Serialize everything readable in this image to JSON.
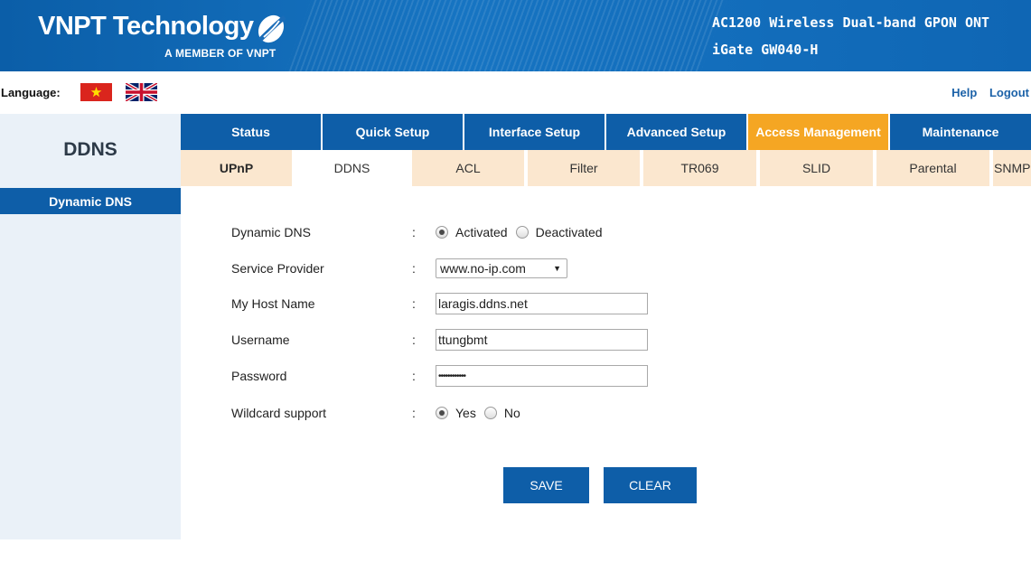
{
  "header": {
    "brand": "VNPT Technology",
    "brand_sub": "A MEMBER OF VNPT",
    "model_line1": "AC1200 Wireless Dual-band GPON ONT",
    "model_line2": "iGate GW040-H"
  },
  "language": {
    "label": "Language:",
    "flags": [
      "vietnam-flag",
      "uk-flag"
    ]
  },
  "top_links": {
    "help": "Help",
    "logout": "Logout"
  },
  "sidebar": {
    "title": "DDNS",
    "items": [
      {
        "label": "Dynamic DNS"
      }
    ]
  },
  "main_nav": {
    "tabs": [
      {
        "label": "Status"
      },
      {
        "label": "Quick Setup"
      },
      {
        "label": "Interface Setup"
      },
      {
        "label": "Advanced Setup"
      },
      {
        "label": "Access Management"
      },
      {
        "label": "Maintenance"
      }
    ],
    "active": "Access Management"
  },
  "sub_nav": {
    "tabs": [
      {
        "label": "UPnP"
      },
      {
        "label": "DDNS"
      },
      {
        "label": "ACL"
      },
      {
        "label": "Filter"
      },
      {
        "label": "TR069"
      },
      {
        "label": "SLID"
      },
      {
        "label": "Parental"
      },
      {
        "label": "SNMP"
      }
    ],
    "active": "DDNS"
  },
  "form": {
    "colon": ":",
    "dynamic_dns": {
      "label": "Dynamic DNS",
      "options": [
        "Activated",
        "Deactivated"
      ],
      "selected": "Activated"
    },
    "service_provider": {
      "label": "Service Provider",
      "value": "www.no-ip.com"
    },
    "host_name": {
      "label": "My Host Name",
      "value": "laragis.ddns.net"
    },
    "username": {
      "label": "Username",
      "value": "ttungbmt"
    },
    "password": {
      "label": "Password",
      "value": "••••••••••••"
    },
    "wildcard": {
      "label": "Wildcard support",
      "options": [
        "Yes",
        "No"
      ],
      "selected": "Yes"
    }
  },
  "buttons": {
    "save": "SAVE",
    "clear": "CLEAR"
  },
  "colors": {
    "brand_blue": "#0e5ea8",
    "active_tab": "#f5a623",
    "subtab_bg": "#fbe7cf",
    "sidebar_bg": "#eaf1f8"
  }
}
